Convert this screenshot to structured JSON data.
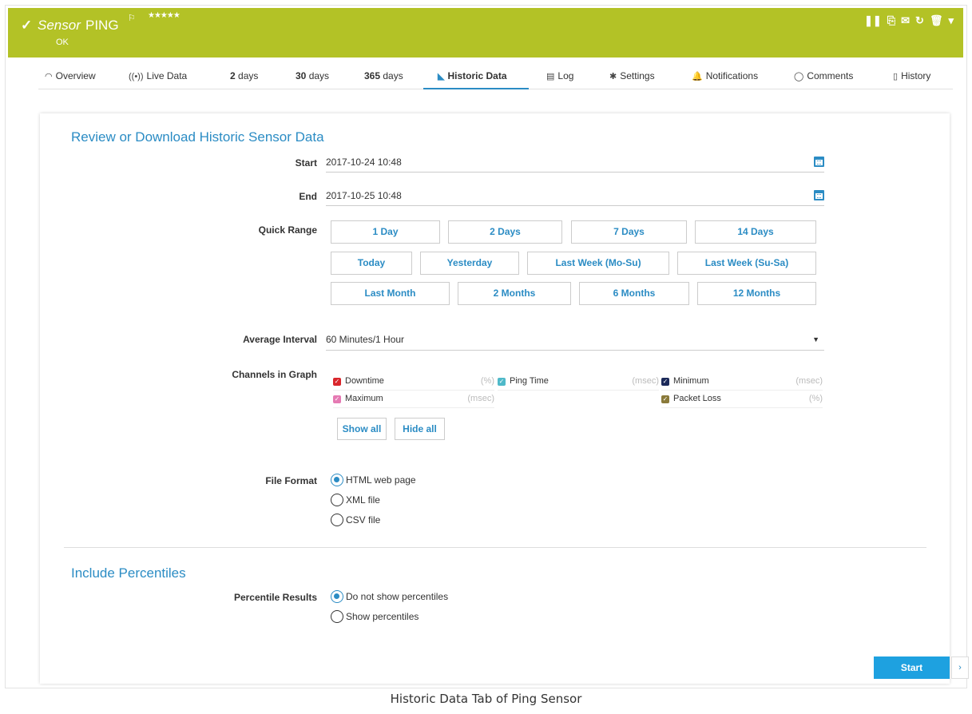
{
  "header": {
    "check": "✓",
    "sensor_word": "Sensor",
    "name": "PING",
    "flag": "⚐",
    "stars": "★★★★★",
    "status": "OK",
    "toolbar": {
      "pause": "❚❚",
      "export": "⎘",
      "mail": "✉",
      "refresh": "↻",
      "delete": "🗑",
      "more": "▾"
    }
  },
  "tabs": {
    "overview": "Overview",
    "live_data": "Live Data",
    "days2_num": "2",
    "days2_unit": "days",
    "days30_num": "30",
    "days30_unit": "days",
    "days365_num": "365",
    "days365_unit": "days",
    "historic": "Historic Data",
    "log": "Log",
    "settings": "Settings",
    "notifications": "Notifications",
    "comments": "Comments",
    "history": "History"
  },
  "form": {
    "title": "Review or Download Historic Sensor Data",
    "start_label": "Start",
    "start_value": "2017-10-24 10:48",
    "end_label": "End",
    "end_value": "2017-10-25 10:48",
    "quick_range_label": "Quick Range",
    "quick_row1": [
      "1 Day",
      "2 Days",
      "7 Days",
      "14 Days"
    ],
    "quick_row2": [
      "Today",
      "Yesterday",
      "Last Week (Mo-Su)",
      "Last Week (Su-Sa)"
    ],
    "quick_row3": [
      "Last Month",
      "2 Months",
      "6 Months",
      "12 Months"
    ],
    "avg_label": "Average Interval",
    "avg_value": "60 Minutes/1 Hour",
    "channels_label": "Channels in Graph",
    "channels": [
      {
        "name": "Downtime",
        "unit": "(%)",
        "color": "#d9262c"
      },
      {
        "name": "Ping Time",
        "unit": "(msec)",
        "color": "#4fb9c9"
      },
      {
        "name": "Minimum",
        "unit": "(msec)",
        "color": "#1c2a5a"
      },
      {
        "name": "Maximum",
        "unit": "(msec)",
        "color": "#e57ab3"
      },
      {
        "name": "Packet Loss",
        "unit": "(%)",
        "color": "#8a7a3a"
      }
    ],
    "show_all": "Show all",
    "hide_all": "Hide all",
    "format_label": "File Format",
    "format_html": "HTML web page",
    "format_xml": "XML file",
    "format_csv": "CSV file",
    "percentiles_title": "Include Percentiles",
    "percentile_label": "Percentile Results",
    "pct_no": "Do not show percentiles",
    "pct_yes": "Show percentiles",
    "start_button": "Start",
    "side_arrow": "›"
  },
  "caption": "Historic Data Tab of Ping Sensor"
}
